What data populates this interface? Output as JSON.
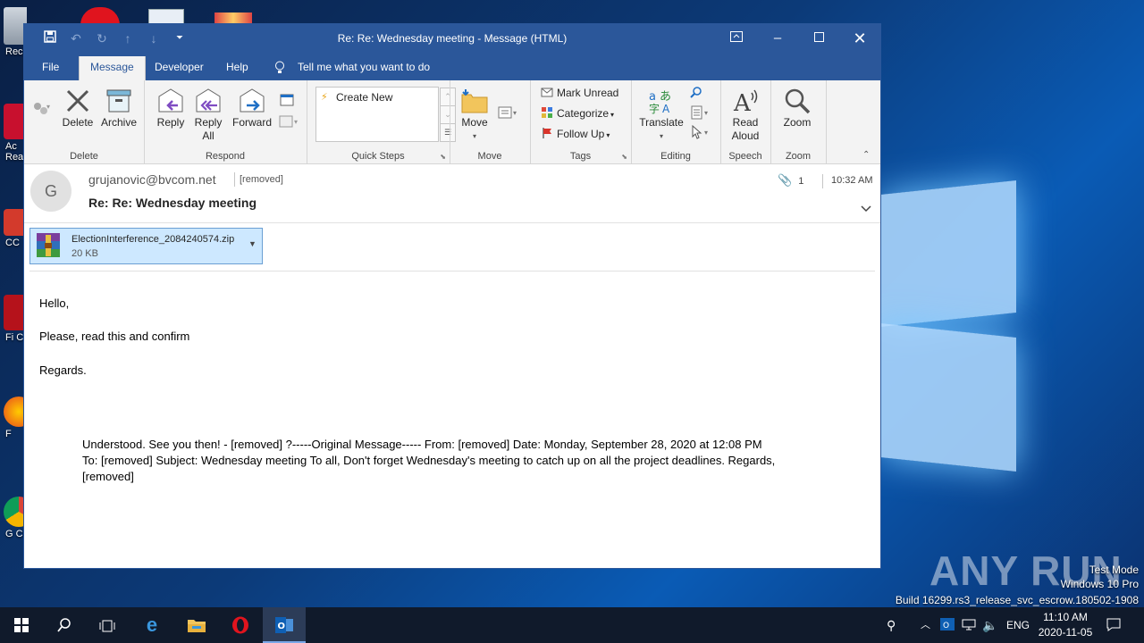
{
  "desktop": {
    "icons": [
      {
        "label": "Rec"
      },
      {
        "label": "Ac Rea"
      },
      {
        "label": "CC"
      },
      {
        "label": "Fi C"
      },
      {
        "label": "F"
      },
      {
        "label": "G Ch"
      }
    ],
    "watermark": {
      "brand": "ANY RUN",
      "line1": "Test Mode",
      "line2": "Windows 10 Pro",
      "line3": "Build 16299.rs3_release_svc_escrow.180502-1908"
    }
  },
  "window": {
    "title": "Re: Re: Wednesday meeting  -  Message (HTML)",
    "menus": {
      "file": "File",
      "message": "Message",
      "developer": "Developer",
      "help": "Help",
      "tell_me": "Tell me what you want to do"
    }
  },
  "ribbon": {
    "delete_group": {
      "label": "Delete",
      "delete": "Delete",
      "archive": "Archive"
    },
    "respond_group": {
      "label": "Respond",
      "reply": "Reply",
      "reply_all_1": "Reply",
      "reply_all_2": "All",
      "forward": "Forward"
    },
    "quick_steps": {
      "label": "Quick Steps",
      "create_new": "Create New"
    },
    "move_group": {
      "label": "Move",
      "move": "Move"
    },
    "tags_group": {
      "label": "Tags",
      "mark_unread": "Mark Unread",
      "categorize": "Categorize",
      "follow_up": "Follow Up"
    },
    "editing_group": {
      "label": "Editing",
      "translate": "Translate"
    },
    "speech_group": {
      "label": "Speech",
      "read_1": "Read",
      "read_2": "Aloud"
    },
    "zoom_group": {
      "label": "Zoom",
      "zoom": "Zoom"
    }
  },
  "message": {
    "avatar_initial": "G",
    "sender": "grujanovic@bvcom.net",
    "to": "[removed]",
    "subject": "Re: Re: Wednesday meeting",
    "attachment_count": "1",
    "time": "10:32 AM",
    "attachment": {
      "name": "ElectionInterference_2084240574.zip",
      "size": "20 KB"
    },
    "body": [
      "Hello,",
      "Please, read this and confirm",
      "Regards."
    ],
    "quoted_line1": "Understood. See you then! - [removed] ?-----Original Message----- From: [removed] Date: Monday, September 28, 2020  at 12:08 PM",
    "quoted_line2": "To: [removed] Subject: Wednesday meeting To all, Don't forget Wednesday's meeting to catch up on all the project deadlines. Regards,",
    "quoted_line3": "[removed]"
  },
  "taskbar": {
    "lang": "ENG",
    "time": "11:10 AM",
    "date": "2020-11-05"
  },
  "colors": {
    "accent": "#2b579a",
    "attachment_bg": "#cde8ff"
  }
}
